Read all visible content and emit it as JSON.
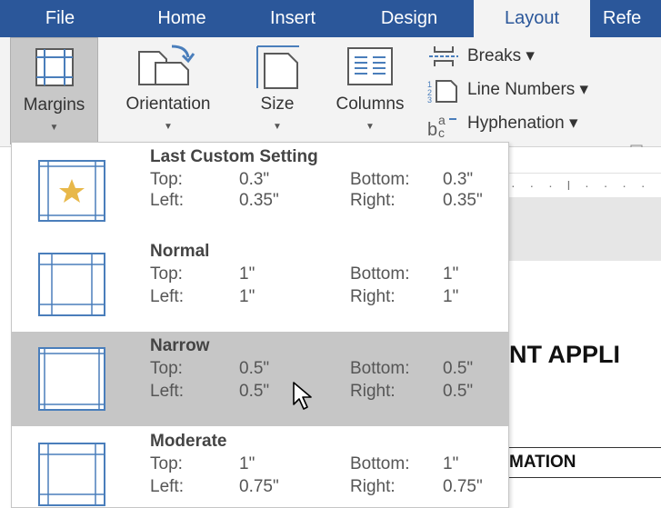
{
  "ribbon_tabs": {
    "file": "File",
    "home": "Home",
    "insert": "Insert",
    "design": "Design",
    "layout": "Layout",
    "references": "Refe"
  },
  "ribbon": {
    "margins_label": "Margins",
    "orientation_label": "Orientation",
    "size_label": "Size",
    "columns_label": "Columns",
    "breaks_label": "Breaks ▾",
    "line_numbers_label": "Line Numbers ▾",
    "hyphenation_label": "Hyphenation ▾",
    "icons": {
      "margins": "margins-icon",
      "orientation": "orientation-icon",
      "size": "size-icon",
      "columns": "columns-icon",
      "breaks": "breaks-icon",
      "line_numbers": "line-numbers-icon",
      "hyphenation": "hyphenation-icon"
    }
  },
  "document": {
    "heading_fragment": "NT APPLI",
    "subheading_fragment": "MATION"
  },
  "margins_menu": {
    "items": [
      {
        "name": "Last Custom Setting",
        "top_label": "Top:",
        "top_value": "0.3\"",
        "bottom_label": "Bottom:",
        "bottom_value": "0.3\"",
        "left_label": "Left:",
        "left_value": "0.35\"",
        "right_label": "Right:",
        "right_value": "0.35\""
      },
      {
        "name": "Normal",
        "top_label": "Top:",
        "top_value": "1\"",
        "bottom_label": "Bottom:",
        "bottom_value": "1\"",
        "left_label": "Left:",
        "left_value": "1\"",
        "right_label": "Right:",
        "right_value": "1\""
      },
      {
        "name": "Narrow",
        "top_label": "Top:",
        "top_value": "0.5\"",
        "bottom_label": "Bottom:",
        "bottom_value": "0.5\"",
        "left_label": "Left:",
        "left_value": "0.5\"",
        "right_label": "Right:",
        "right_value": "0.5\""
      },
      {
        "name": "Moderate",
        "top_label": "Top:",
        "top_value": "1\"",
        "bottom_label": "Bottom:",
        "bottom_value": "1\"",
        "left_label": "Left:",
        "left_value": "0.75\"",
        "right_label": "Right:",
        "right_value": "0.75\""
      }
    ],
    "hovered_item": "Narrow"
  },
  "colors": {
    "tab_bar": "#2b579a",
    "ribbon_bg": "#f3f3f3",
    "hover_bg": "#c6c6c6",
    "margin_line": "#4a7ebb",
    "star": "#e8b84a"
  }
}
